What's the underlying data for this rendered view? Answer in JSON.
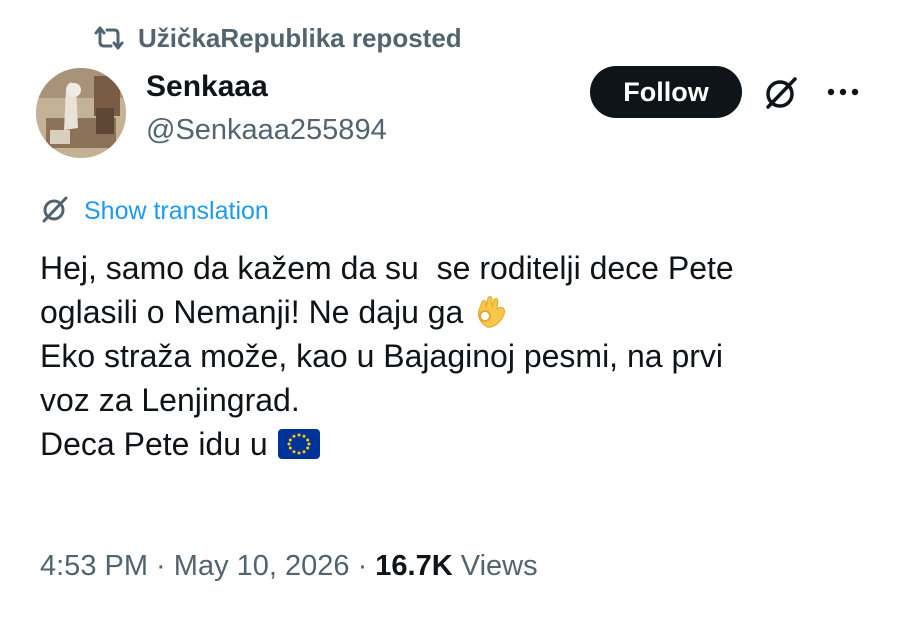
{
  "repost": {
    "icon": "repost-icon",
    "text": "UžičkaRepublika reposted"
  },
  "author": {
    "avatar": "avatar",
    "display_name": "Senkaaa",
    "handle": "@Senkaaa255894"
  },
  "actions": {
    "follow_label": "Follow",
    "grok_icon": "grok-icon",
    "more_icon": "more-icon"
  },
  "translation": {
    "icon": "translate-icon",
    "label": "Show translation"
  },
  "tweet": {
    "lines": [
      "Hej, samo da kažem da su  se roditelji dece Pete",
      "oglasili o Nemanji! Ne daju ga",
      "Eko straža može, kao u Bajaginoj pesmi, na prvi",
      "voz za Lenjingrad.",
      "Deca Pete idu u"
    ],
    "emojis": {
      "line_2": "ok-hand-emoji",
      "line_5": "eu-flag-emoji"
    }
  },
  "meta": {
    "time": "4:53 PM",
    "separator": " · ",
    "date": "May 10, 2026",
    "views_count": "16.7K",
    "views_label": " Views"
  },
  "colors": {
    "text_primary": "#0f1419",
    "text_secondary": "#536471",
    "link_blue": "#1d9bf0",
    "button_bg": "#0f1419",
    "eu_blue": "#003399",
    "eu_gold": "#ffcc00"
  }
}
